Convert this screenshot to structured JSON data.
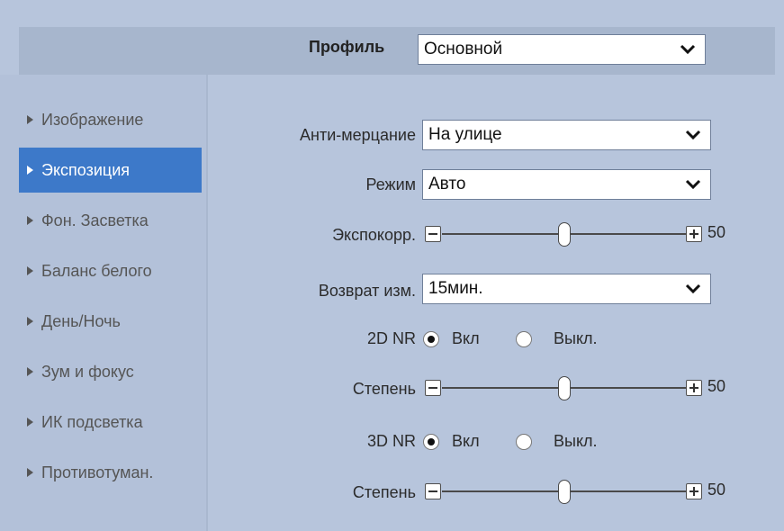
{
  "colors": {
    "page_bg": "#b7c5dc",
    "sidebar_bg": "#b3c1d9",
    "active_item_bg": "#3d79c9",
    "active_item_text": "#ffffff"
  },
  "profile": {
    "label": "Профиль",
    "value": "Основной"
  },
  "sidebar": {
    "active_index": 1,
    "items": [
      {
        "label": "Изображение"
      },
      {
        "label": "Экспозиция"
      },
      {
        "label": "Фон. Засветка"
      },
      {
        "label": "Баланс белого"
      },
      {
        "label": "День/Ночь"
      },
      {
        "label": "Зум и фокус"
      },
      {
        "label": "ИК подсветка"
      },
      {
        "label": "Противотуман."
      }
    ]
  },
  "settings": {
    "anti_flicker": {
      "label": "Анти-мерцание",
      "value": "На улице"
    },
    "mode": {
      "label": "Режим",
      "value": "Авто"
    },
    "exposure_comp": {
      "label": "Экспокорр.",
      "value": "50",
      "level": 50
    },
    "restore_time": {
      "label": "Возврат изм.",
      "value": "15мин."
    },
    "nr2d": {
      "label": "2D NR",
      "on_label": "Вкл",
      "off_label": "Выкл.",
      "selected": "on"
    },
    "nr2d_level": {
      "label": "Степень",
      "value": "50",
      "level": 50
    },
    "nr3d": {
      "label": "3D NR",
      "on_label": "Вкл",
      "off_label": "Выкл.",
      "selected": "on"
    },
    "nr3d_level": {
      "label": "Степень",
      "value": "50",
      "level": 50
    }
  },
  "icons": {
    "dropdown": "chevron-down-icon",
    "sidebar_bullet": "triangle-right-icon",
    "slider_minus": "minus-icon",
    "slider_plus": "plus-icon"
  }
}
